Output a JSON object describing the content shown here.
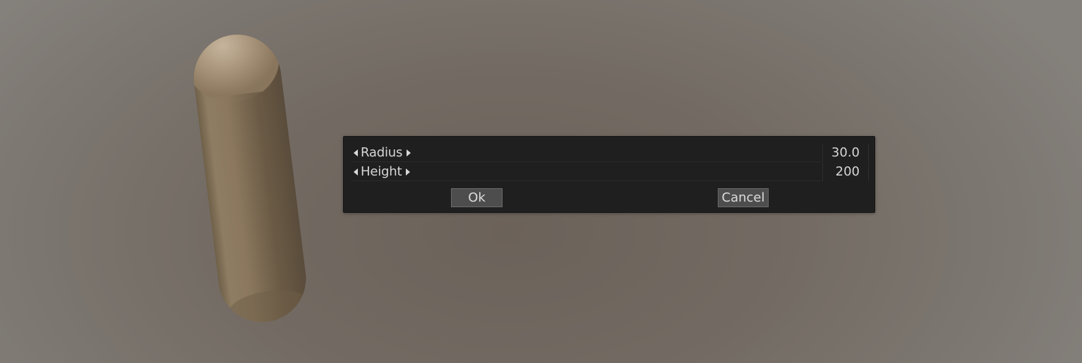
{
  "dialog": {
    "params": [
      {
        "label": "Radius",
        "value": "30.0"
      },
      {
        "label": "Height",
        "value": "200"
      }
    ],
    "ok_label": "Ok",
    "cancel_label": "Cancel"
  },
  "colors": {
    "background": "#736b63",
    "dialog_bg": "#1f1f1f",
    "button_bg": "#4d4d4d",
    "text": "#d6d6d6",
    "capsule": "#8a7760"
  },
  "icons": {
    "decrement": "triangle-left-icon",
    "increment": "triangle-right-icon"
  }
}
